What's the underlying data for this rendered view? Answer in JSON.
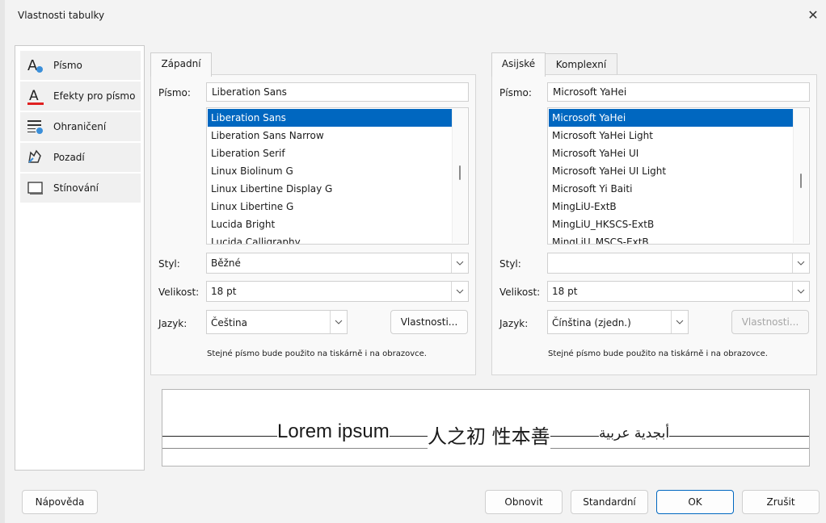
{
  "window": {
    "title": "Vlastnosti tabulky",
    "close_glyph": "✕"
  },
  "sidebar": {
    "items": [
      {
        "label": "Písmo",
        "icon": "font-icon"
      },
      {
        "label": "Efekty pro písmo",
        "icon": "font-effects-icon"
      },
      {
        "label": "Ohraničení",
        "icon": "borders-icon"
      },
      {
        "label": "Pozadí",
        "icon": "background-icon"
      },
      {
        "label": "Stínování",
        "icon": "shadow-icon"
      }
    ]
  },
  "western": {
    "tab": "Západní",
    "font_label": "Písmo:",
    "font_value": "Liberation Sans",
    "font_list": [
      "Liberation Sans",
      "Liberation Sans Narrow",
      "Liberation Serif",
      "Linux Biolinum G",
      "Linux Libertine Display G",
      "Linux Libertine G",
      "Lucida Bright",
      "Lucida Calligraphy"
    ],
    "style_label": "Styl:",
    "style_value": "Běžné",
    "size_label": "Velikost:",
    "size_value": "18 pt",
    "lang_label": "Jazyk:",
    "lang_value": "Čeština",
    "features_button": "Vlastnosti...",
    "note": "Stejné písmo bude použito na tiskárně i na obrazovce."
  },
  "asian": {
    "tab": "Asijské",
    "complex_tab": "Komplexní",
    "font_label": "Písmo:",
    "font_value": "Microsoft YaHei",
    "font_list": [
      "Microsoft YaHei",
      "Microsoft YaHei Light",
      "Microsoft YaHei UI",
      "Microsoft YaHei UI Light",
      "Microsoft Yi Baiti",
      "MingLiU-ExtB",
      "MingLiU_HKSCS-ExtB",
      "MingLiU_MSCS-ExtB"
    ],
    "style_label": "Styl:",
    "style_value": "",
    "size_label": "Velikost:",
    "size_value": "18 pt",
    "lang_label": "Jazyk:",
    "lang_value": "Čínština (zjedn.)",
    "features_button": "Vlastnosti...",
    "note": "Stejné písmo bude použito na tiskárně i na obrazovce."
  },
  "preview": {
    "western_text": "Lorem ipsum",
    "asian_text": "人之初 性本善",
    "complex_text": "أبجدية عربية"
  },
  "footer": {
    "help": "Nápověda",
    "reset": "Obnovit",
    "standard": "Standardní",
    "ok": "OK",
    "cancel": "Zrušit"
  },
  "colors": {
    "selection": "#0067c0",
    "accent_underline": "#e02020",
    "icon_blue": "#3b8fd9"
  }
}
